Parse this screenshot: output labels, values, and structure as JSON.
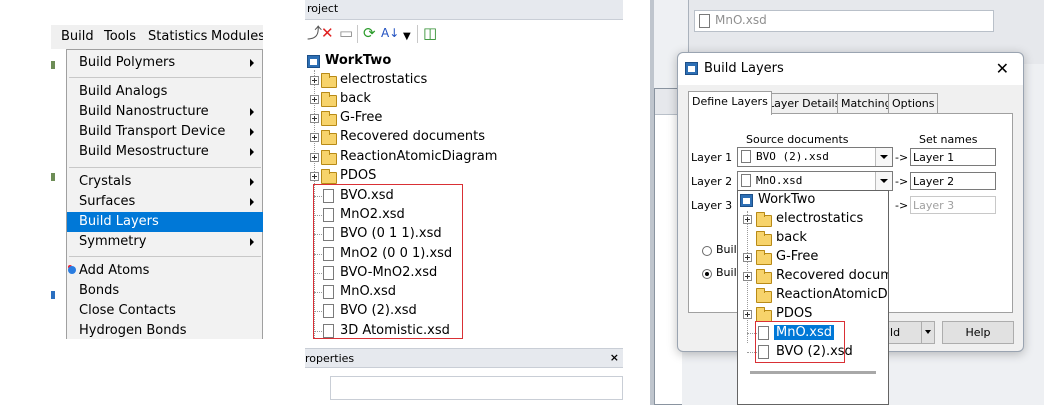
{
  "menu_panel": {
    "menubar": [
      "Build",
      "Tools",
      "Statistics",
      "Modules"
    ],
    "items": [
      {
        "label": "Build Polymers",
        "submenu": true
      },
      {
        "label": "Build Analogs",
        "submenu": false
      },
      {
        "label": "Build Nanostructure",
        "submenu": true
      },
      {
        "label": "Build Transport Device",
        "submenu": true
      },
      {
        "label": "Build Mesostructure",
        "submenu": true
      },
      {
        "label": "Crystals",
        "submenu": true
      },
      {
        "label": "Surfaces",
        "submenu": true
      },
      {
        "label": "Build Layers",
        "submenu": false,
        "selected": true
      },
      {
        "label": "Symmetry",
        "submenu": true
      },
      {
        "label": "Add Atoms",
        "submenu": false,
        "icon": "atom-icon"
      },
      {
        "label": "Bonds",
        "submenu": false
      },
      {
        "label": "Close Contacts",
        "submenu": false
      },
      {
        "label": "Hydrogen Bonds",
        "submenu": false
      }
    ]
  },
  "project_panel": {
    "title": "roject",
    "root": "WorkTwo",
    "folders": [
      "electrostatics",
      "back",
      "G-Free",
      "Recovered documents",
      "ReactionAtomicDiagram",
      "PDOS"
    ],
    "documents": [
      "BVO.xsd",
      "MnO2.xsd",
      "BVO (0 1 1).xsd",
      "MnO2 (0 0 1).xsd",
      "BVO-MnO2.xsd",
      "MnO.xsd",
      "BVO (2).xsd",
      "3D Atomistic.xsd"
    ],
    "properties_title": "roperties",
    "toolbar_icons": [
      "new-icon",
      "delete-icon",
      "new-folder-icon",
      "refresh-icon",
      "sort-icon",
      "dropdown-icon",
      "book-icon"
    ]
  },
  "dialog_panel": {
    "background_tab": "MnO.xsd",
    "title": "Build Layers",
    "tabs": [
      "Define Layers",
      "Layer Details",
      "Matching",
      "Options"
    ],
    "col_source": "Source documents",
    "col_set": "Set names",
    "layers": [
      {
        "label": "Layer 1",
        "source": "BVO (2).xsd",
        "set_name": "Layer 1"
      },
      {
        "label": "Layer 2",
        "source": "MnO.xsd",
        "set_name": "Layer 2"
      },
      {
        "label": "Layer 3",
        "source": "",
        "set_name": "Layer 3"
      }
    ],
    "arrow_text": "->",
    "radio_1": "Build",
    "radio_2": "Build",
    "build_button": "ild",
    "help_button": "Help",
    "dropdown": {
      "root": "WorkTwo",
      "folders": [
        "electrostatics",
        "back",
        "G-Free",
        "Recovered documer",
        "ReactionAtomicDiag",
        "PDOS"
      ],
      "documents": [
        "MnO.xsd",
        "BVO (2).xsd"
      ],
      "selected": "MnO.xsd"
    }
  },
  "colors": {
    "selection": "#0078d7",
    "highlight_box": "#d93035"
  }
}
